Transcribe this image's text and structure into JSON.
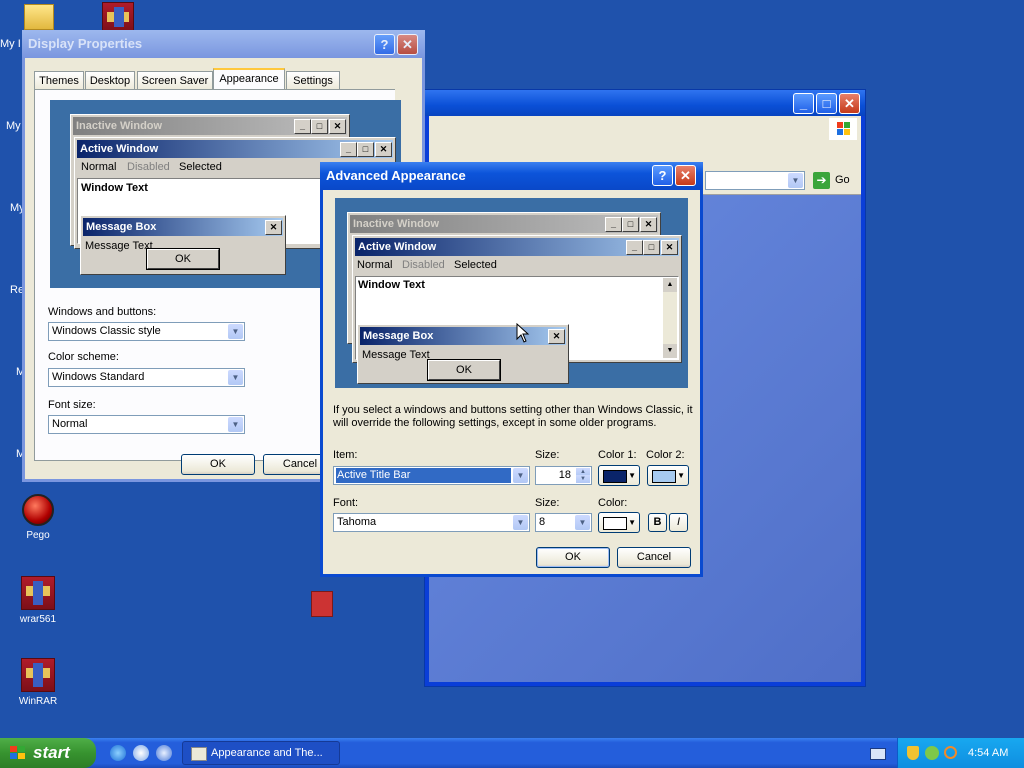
{
  "desktop": {
    "icons": [
      {
        "label": "Pego"
      },
      {
        "label": "wrar561"
      },
      {
        "label": "WinRAR"
      }
    ],
    "edge_labels": [
      "My I",
      "My",
      "My",
      "Re",
      "M",
      "M"
    ]
  },
  "bg_window": {
    "go_label": "Go"
  },
  "display_props": {
    "title": "Display Properties",
    "tabs": [
      "Themes",
      "Desktop",
      "Screen Saver",
      "Appearance",
      "Settings"
    ],
    "selected_tab": "Appearance",
    "preview": {
      "inactive_title": "Inactive Window",
      "active_title": "Active Window",
      "menu": {
        "normal": "Normal",
        "disabled": "Disabled",
        "selected": "Selected"
      },
      "window_text": "Window Text",
      "msgbox_title": "Message Box",
      "msgbox_text": "Message Text",
      "ok": "OK"
    },
    "windows_buttons_label": "Windows and buttons:",
    "windows_buttons_value": "Windows Classic style",
    "color_scheme_label": "Color scheme:",
    "color_scheme_value": "Windows Standard",
    "font_size_label": "Font size:",
    "font_size_value": "Normal",
    "ok": "OK",
    "cancel": "Cancel"
  },
  "advanced": {
    "title": "Advanced Appearance",
    "preview": {
      "inactive_title": "Inactive Window",
      "active_title": "Active Window",
      "menu": {
        "normal": "Normal",
        "disabled": "Disabled",
        "selected": "Selected"
      },
      "window_text": "Window Text",
      "msgbox_title": "Message Box",
      "msgbox_text": "Message Text",
      "ok": "OK"
    },
    "info_text": "If you select a windows and buttons setting other than Windows Classic, it will override the following settings, except in some older programs.",
    "item_label": "Item:",
    "item_value": "Active Title Bar",
    "size_label": "Size:",
    "size_value": "18",
    "color1_label": "Color 1:",
    "color2_label": "Color 2:",
    "color1": "#0a246a",
    "color2": "#a6caf0",
    "font_label": "Font:",
    "font_value": "Tahoma",
    "font_size_label": "Size:",
    "font_size_value": "8",
    "font_color_label": "Color:",
    "font_color": "#ffffff",
    "bold": "B",
    "italic": "I",
    "ok": "OK",
    "cancel": "Cancel"
  },
  "taskbar": {
    "start_label": "start",
    "task_item": "Appearance and The...",
    "clock": "4:54 AM"
  }
}
